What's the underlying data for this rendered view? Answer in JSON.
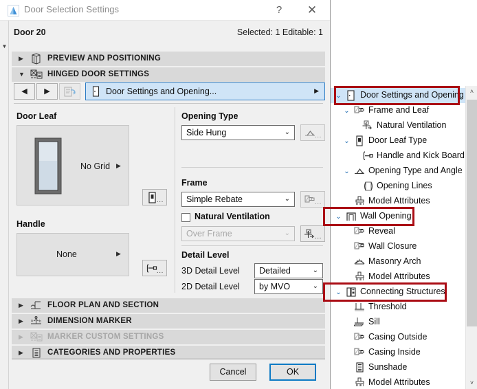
{
  "window": {
    "title": "Door Selection Settings",
    "app_icon": "archicad-icon",
    "help_button": "?",
    "close_button": "✕"
  },
  "object": {
    "name": "Door 20",
    "selection_info": "Selected: 1 Editable: 1"
  },
  "sections": [
    {
      "label": "PREVIEW AND POSITIONING",
      "expanded": false,
      "enabled": true,
      "icon": "preview-cube-icon"
    },
    {
      "label": "HINGED DOOR SETTINGS",
      "expanded": true,
      "enabled": true,
      "icon": "hinged-door-icon"
    },
    {
      "label": "FLOOR PLAN AND SECTION",
      "expanded": false,
      "enabled": true,
      "icon": "floor-plan-icon"
    },
    {
      "label": "DIMENSION MARKER",
      "expanded": false,
      "enabled": true,
      "icon": "dimension-marker-icon"
    },
    {
      "label": "MARKER CUSTOM SETTINGS",
      "expanded": false,
      "enabled": false,
      "icon": "marker-custom-icon"
    },
    {
      "label": "CATEGORIES AND PROPERTIES",
      "expanded": false,
      "enabled": true,
      "icon": "categories-icon"
    }
  ],
  "navbar": {
    "back_label": "◀",
    "forward_label": "▶",
    "jump_label": "jump-to-icon",
    "current_page": "Door Settings and Opening...",
    "page_icon": "door-settings-icon",
    "page_arrow": "▶"
  },
  "door_leaf": {
    "group_title": "Door Leaf",
    "grid_value": "No Grid",
    "grid_arrow": "▶",
    "settings_button_icon": "door-leaf-icon",
    "settings_button_dots": "..."
  },
  "handle": {
    "group_title": "Handle",
    "value": "None",
    "arrow": "▶",
    "settings_button_icon": "handle-icon",
    "settings_button_dots": "..."
  },
  "opening_type": {
    "group_title": "Opening Type",
    "value": "Side Hung",
    "chevron": "⌄",
    "settings_button_icon": "opening-angle-icon",
    "settings_button_dots": "..."
  },
  "frame": {
    "group_title": "Frame",
    "value": "Simple Rebate",
    "chevron": "⌄",
    "settings_button_icon": "frame-icon",
    "settings_button_dots": "..."
  },
  "natural_ventilation": {
    "label": "Natural Ventilation",
    "checked": false,
    "value": "Over Frame",
    "chevron": "⌄",
    "settings_button_icon": "ventilation-icon",
    "settings_button_dots": "..."
  },
  "detail_level": {
    "group_title": "Detail Level",
    "rows": [
      {
        "label": "3D Detail Level",
        "value": "Detailed",
        "chevron": "⌄"
      },
      {
        "label": "2D Detail Level",
        "value": "by MVO",
        "chevron": "⌄"
      }
    ]
  },
  "footer": {
    "cancel_label": "Cancel",
    "ok_label": "OK"
  },
  "tree": {
    "items": [
      {
        "label": "Door Settings and Opening",
        "depth": 0,
        "chevron": "⌄",
        "icon": "door-settings-icon",
        "selected": true,
        "highlighted": true
      },
      {
        "label": "Frame and Leaf",
        "depth": 1,
        "chevron": "⌄",
        "icon": "frame-icon",
        "selected": false,
        "highlighted": false
      },
      {
        "label": "Natural Ventilation",
        "depth": 2,
        "chevron": "",
        "icon": "ventilation-icon",
        "selected": false,
        "highlighted": false
      },
      {
        "label": "Door Leaf Type",
        "depth": 1,
        "chevron": "⌄",
        "icon": "door-leaf-icon",
        "selected": false,
        "highlighted": false
      },
      {
        "label": "Handle and Kick Board",
        "depth": 2,
        "chevron": "",
        "icon": "handle-icon",
        "selected": false,
        "highlighted": false
      },
      {
        "label": "Opening Type and Angle",
        "depth": 1,
        "chevron": "⌄",
        "icon": "opening-angle-icon",
        "selected": false,
        "highlighted": false
      },
      {
        "label": "Opening Lines",
        "depth": 2,
        "chevron": "",
        "icon": "opening-lines-icon",
        "selected": false,
        "highlighted": false
      },
      {
        "label": "Model Attributes",
        "depth": 1,
        "chevron": "",
        "icon": "model-attributes-icon",
        "selected": false,
        "highlighted": false
      },
      {
        "label": "Wall Opening",
        "depth": 0,
        "chevron": "⌄",
        "icon": "wall-opening-icon",
        "selected": false,
        "highlighted": true
      },
      {
        "label": "Reveal",
        "depth": 1,
        "chevron": "",
        "icon": "reveal-icon",
        "selected": false,
        "highlighted": false
      },
      {
        "label": "Wall Closure",
        "depth": 1,
        "chevron": "",
        "icon": "wall-closure-icon",
        "selected": false,
        "highlighted": false
      },
      {
        "label": "Masonry Arch",
        "depth": 1,
        "chevron": "",
        "icon": "masonry-arch-icon",
        "selected": false,
        "highlighted": false
      },
      {
        "label": "Model Attributes",
        "depth": 1,
        "chevron": "",
        "icon": "model-attributes-icon",
        "selected": false,
        "highlighted": false
      },
      {
        "label": "Connecting Structures",
        "depth": 0,
        "chevron": "⌄",
        "icon": "connecting-structures-icon",
        "selected": false,
        "highlighted": true
      },
      {
        "label": "Threshold",
        "depth": 1,
        "chevron": "",
        "icon": "threshold-icon",
        "selected": false,
        "highlighted": false
      },
      {
        "label": "Sill",
        "depth": 1,
        "chevron": "",
        "icon": "sill-icon",
        "selected": false,
        "highlighted": false
      },
      {
        "label": "Casing Outside",
        "depth": 1,
        "chevron": "",
        "icon": "casing-outside-icon",
        "selected": false,
        "highlighted": false
      },
      {
        "label": "Casing Inside",
        "depth": 1,
        "chevron": "",
        "icon": "casing-inside-icon",
        "selected": false,
        "highlighted": false
      },
      {
        "label": "Sunshade",
        "depth": 1,
        "chevron": "",
        "icon": "sunshade-icon",
        "selected": false,
        "highlighted": false
      },
      {
        "label": "Model Attributes",
        "depth": 1,
        "chevron": "",
        "icon": "model-attributes-icon",
        "selected": false,
        "highlighted": false
      }
    ],
    "scrollbar": {
      "up_arrow": "˄",
      "down_arrow": "˅"
    }
  },
  "colors": {
    "selection_blue": "#cfe4f7",
    "selection_border": "#2d7cc4",
    "highlight_red": "#aa0c14",
    "ok_border": "#0d7ac4",
    "section_bar": "#d9d9d9",
    "dialog_bg": "#f0f0f0"
  }
}
